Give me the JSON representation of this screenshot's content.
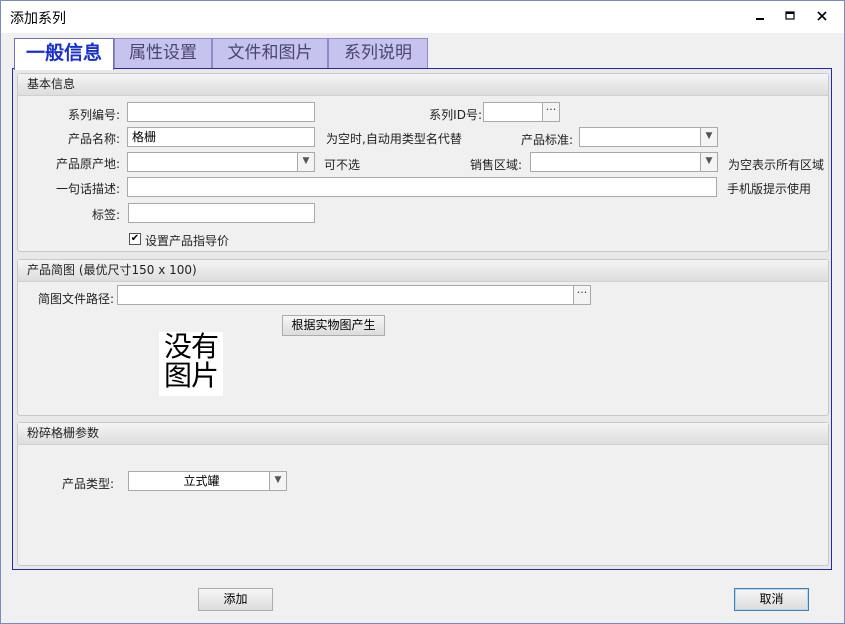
{
  "window": {
    "title": "添加系列"
  },
  "tabs": [
    {
      "label": "一般信息"
    },
    {
      "label": "属性设置"
    },
    {
      "label": "文件和图片"
    },
    {
      "label": "系列说明"
    }
  ],
  "basic_info": {
    "header": "基本信息",
    "series_no_label": "系列编号:",
    "series_no_value": "",
    "series_id_label": "系列ID号:",
    "series_id_value": "",
    "product_name_label": "产品名称:",
    "product_name_value": "格栅",
    "product_name_note": "为空时,自动用类型名代替",
    "product_standard_label": "产品标准:",
    "product_standard_value": "",
    "origin_label": "产品原产地:",
    "origin_value": "",
    "origin_note": "可不选",
    "sales_region_label": "销售区域:",
    "sales_region_value": "",
    "sales_region_note": "为空表示所有区域",
    "description_label": "一句话描述:",
    "description_value": "",
    "description_note": "手机版提示使用",
    "tag_label": "标签:",
    "tag_value": "",
    "guide_price_label": "设置产品指导价",
    "guide_price_checked": "✔"
  },
  "thumbnail": {
    "header": "产品简图 (最优尺寸150 x 100)",
    "path_label": "简图文件路径:",
    "path_value": "",
    "generate_button": "根据实物图产生",
    "no_image_line1": "没有",
    "no_image_line2": "图片"
  },
  "crusher": {
    "header": "粉碎格栅参数",
    "product_type_label": "产品类型:",
    "product_type_value": "立式罐"
  },
  "footer": {
    "add_button": "添加",
    "cancel_button": "取消"
  },
  "icons": {
    "ellipsis": "···",
    "dropdown": "▼"
  }
}
